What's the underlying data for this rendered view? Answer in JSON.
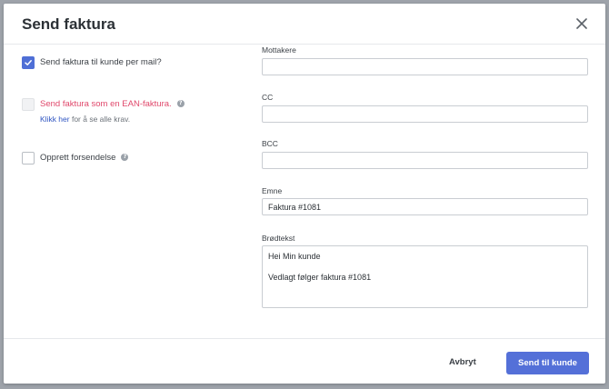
{
  "modal": {
    "title": "Send faktura",
    "close_icon": "close-icon"
  },
  "options": {
    "send_mail": {
      "label": "Send faktura til kunde per mail?",
      "checked": true
    },
    "ean": {
      "label": "Send faktura som en EAN-faktura.",
      "checked": false,
      "disabled": true,
      "link_text": "Klikk her",
      "link_suffix": "for å se alle krav."
    },
    "shipment": {
      "label": "Opprett forsendelse",
      "checked": false
    }
  },
  "fields": {
    "recipients": {
      "label": "Mottakere",
      "value": ""
    },
    "cc": {
      "label": "CC",
      "value": ""
    },
    "bcc": {
      "label": "BCC",
      "value": ""
    },
    "subject": {
      "label": "Emne",
      "value": "Faktura #1081"
    },
    "body": {
      "label": "Brødtekst",
      "line1": "Hei Min kunde",
      "line2": "Vedlagt følger faktura #1081"
    }
  },
  "footer": {
    "cancel_label": "Avbryt",
    "submit_label": "Send til kunde"
  },
  "colors": {
    "accent": "#5470d8",
    "error": "#e0486b",
    "link": "#2f55c2"
  }
}
